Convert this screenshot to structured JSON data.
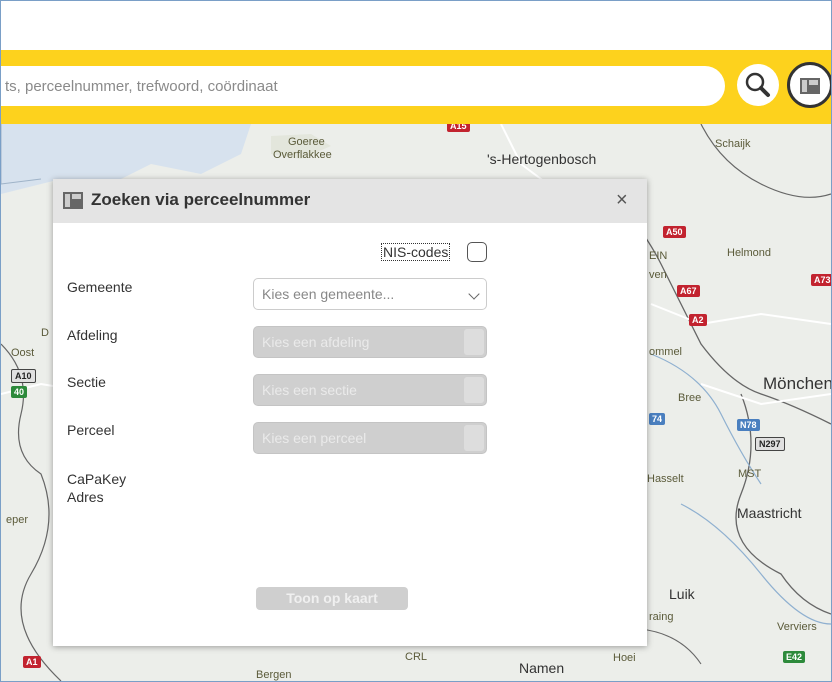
{
  "search": {
    "placeholder": "ts, perceelnummer, trefwoord, coördinaat"
  },
  "toolbar": {
    "search_icon": "search-icon",
    "map_icon": "map-panel-icon"
  },
  "map": {
    "labels": [
      {
        "text": "Goeree",
        "cls": "small"
      },
      {
        "text": "Overflakkee",
        "cls": "small"
      },
      {
        "text": "'s-Hertogenbosch",
        "cls": ""
      },
      {
        "text": "Schaijk",
        "cls": "small"
      },
      {
        "text": "Helmond",
        "cls": "small"
      },
      {
        "text": "Mönchen",
        "cls": "big"
      },
      {
        "text": "Bree",
        "cls": "small"
      },
      {
        "text": "Hasselt",
        "cls": "small"
      },
      {
        "text": "Maastricht",
        "cls": ""
      },
      {
        "text": "Luik",
        "cls": ""
      },
      {
        "text": "Verviers",
        "cls": "small"
      },
      {
        "text": "Namen",
        "cls": ""
      },
      {
        "text": "Bergen",
        "cls": "small"
      },
      {
        "text": "Oost",
        "cls": "small"
      },
      {
        "text": "eper",
        "cls": "small"
      },
      {
        "text": "ommel",
        "cls": "small"
      },
      {
        "text": "ven",
        "cls": "small"
      },
      {
        "text": "raing",
        "cls": "small"
      },
      {
        "text": "Hoei",
        "cls": "small"
      },
      {
        "text": "EIN",
        "cls": "small"
      },
      {
        "text": "MST",
        "cls": "small"
      },
      {
        "text": "CRL",
        "cls": "small"
      },
      {
        "text": "D",
        "cls": "small"
      }
    ],
    "shields": [
      "A50",
      "A67",
      "A2",
      "A10",
      "40",
      "74",
      "N78",
      "N297",
      "A1",
      "E42",
      "A15",
      "A73"
    ]
  },
  "dialog": {
    "title": "Zoeken via perceelnummer",
    "close": "×",
    "nis_label": "NIS-codes",
    "gemeente_label": "Gemeente",
    "gemeente_placeholder": "Kies een gemeente...",
    "afdeling_label": "Afdeling",
    "afdeling_placeholder": "Kies een afdeling",
    "sectie_label": "Sectie",
    "sectie_placeholder": "Kies een sectie",
    "perceel_label": "Perceel",
    "perceel_placeholder": "Kies een perceel",
    "capakey_label": "CaPaKey",
    "adres_label": "Adres",
    "submit_label": "Toon op kaart"
  },
  "colors": {
    "accent": "#fdd21d",
    "disabled": "#cfcfcf"
  }
}
